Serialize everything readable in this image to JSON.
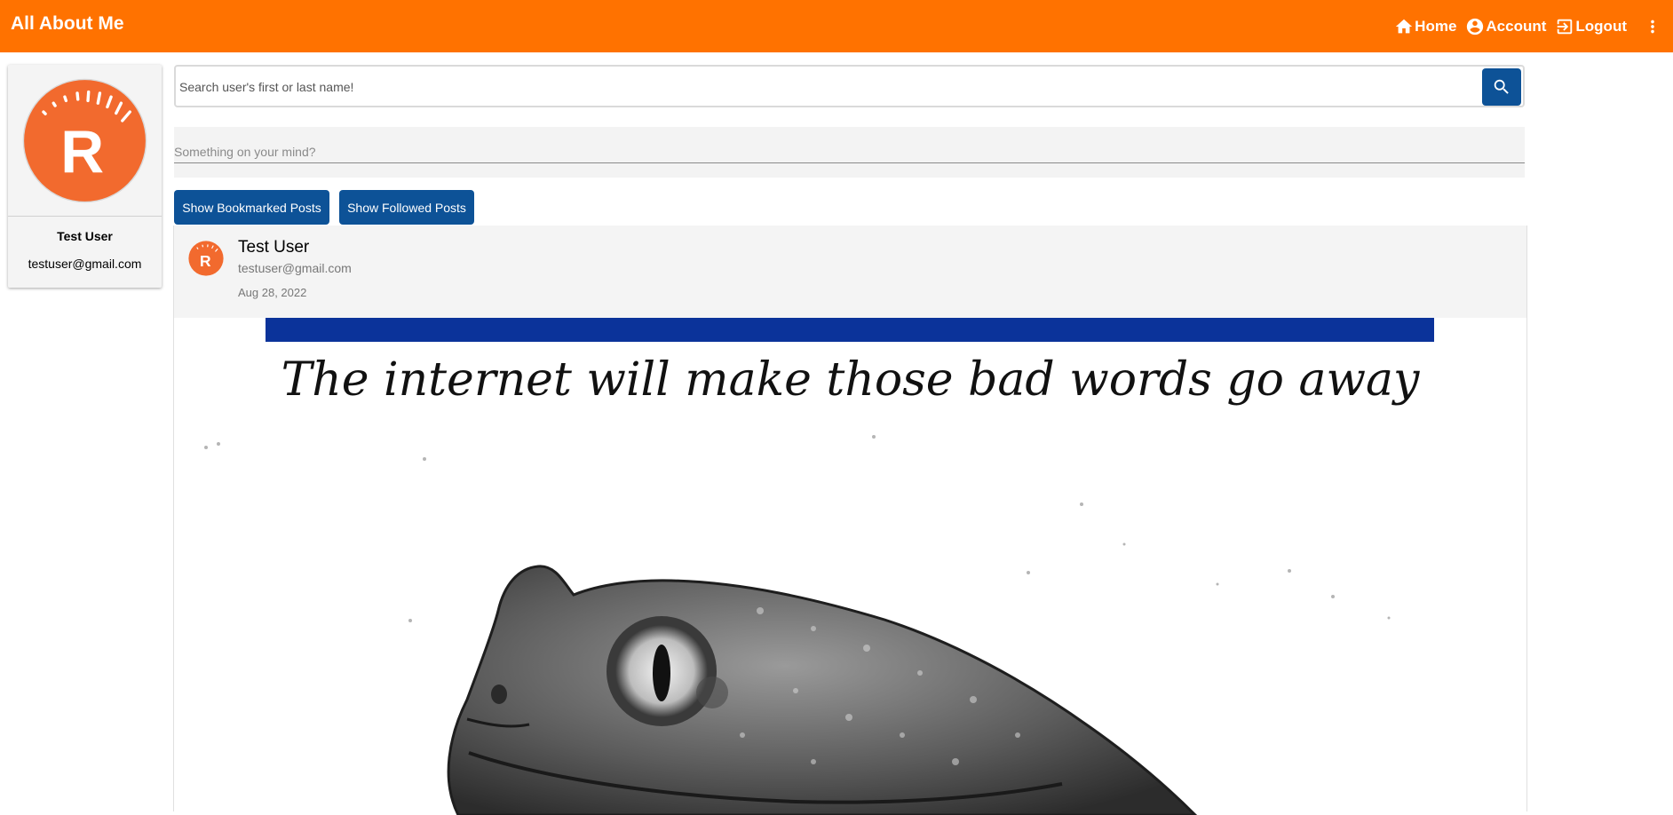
{
  "app": {
    "title": "All About Me"
  },
  "nav": {
    "home": "Home",
    "account": "Account",
    "logout": "Logout"
  },
  "profile": {
    "name": "Test User",
    "email": "testuser@gmail.com",
    "avatar_letter": "R"
  },
  "search": {
    "placeholder": "Search user's first or last name!"
  },
  "composer": {
    "placeholder": "Something on your mind?"
  },
  "buttons": {
    "bookmarked": "Show Bookmarked Posts",
    "followed": "Show Followed Posts"
  },
  "post": {
    "author": "Test User",
    "email": "testuser@gmail.com",
    "date": "Aug 28, 2022",
    "image_caption": "The internet will make those bad words go away"
  },
  "colors": {
    "appbar": "#ff7200",
    "primary": "#0d5297",
    "avatar": "#f26a2e",
    "meme_bar": "#0b339a"
  }
}
